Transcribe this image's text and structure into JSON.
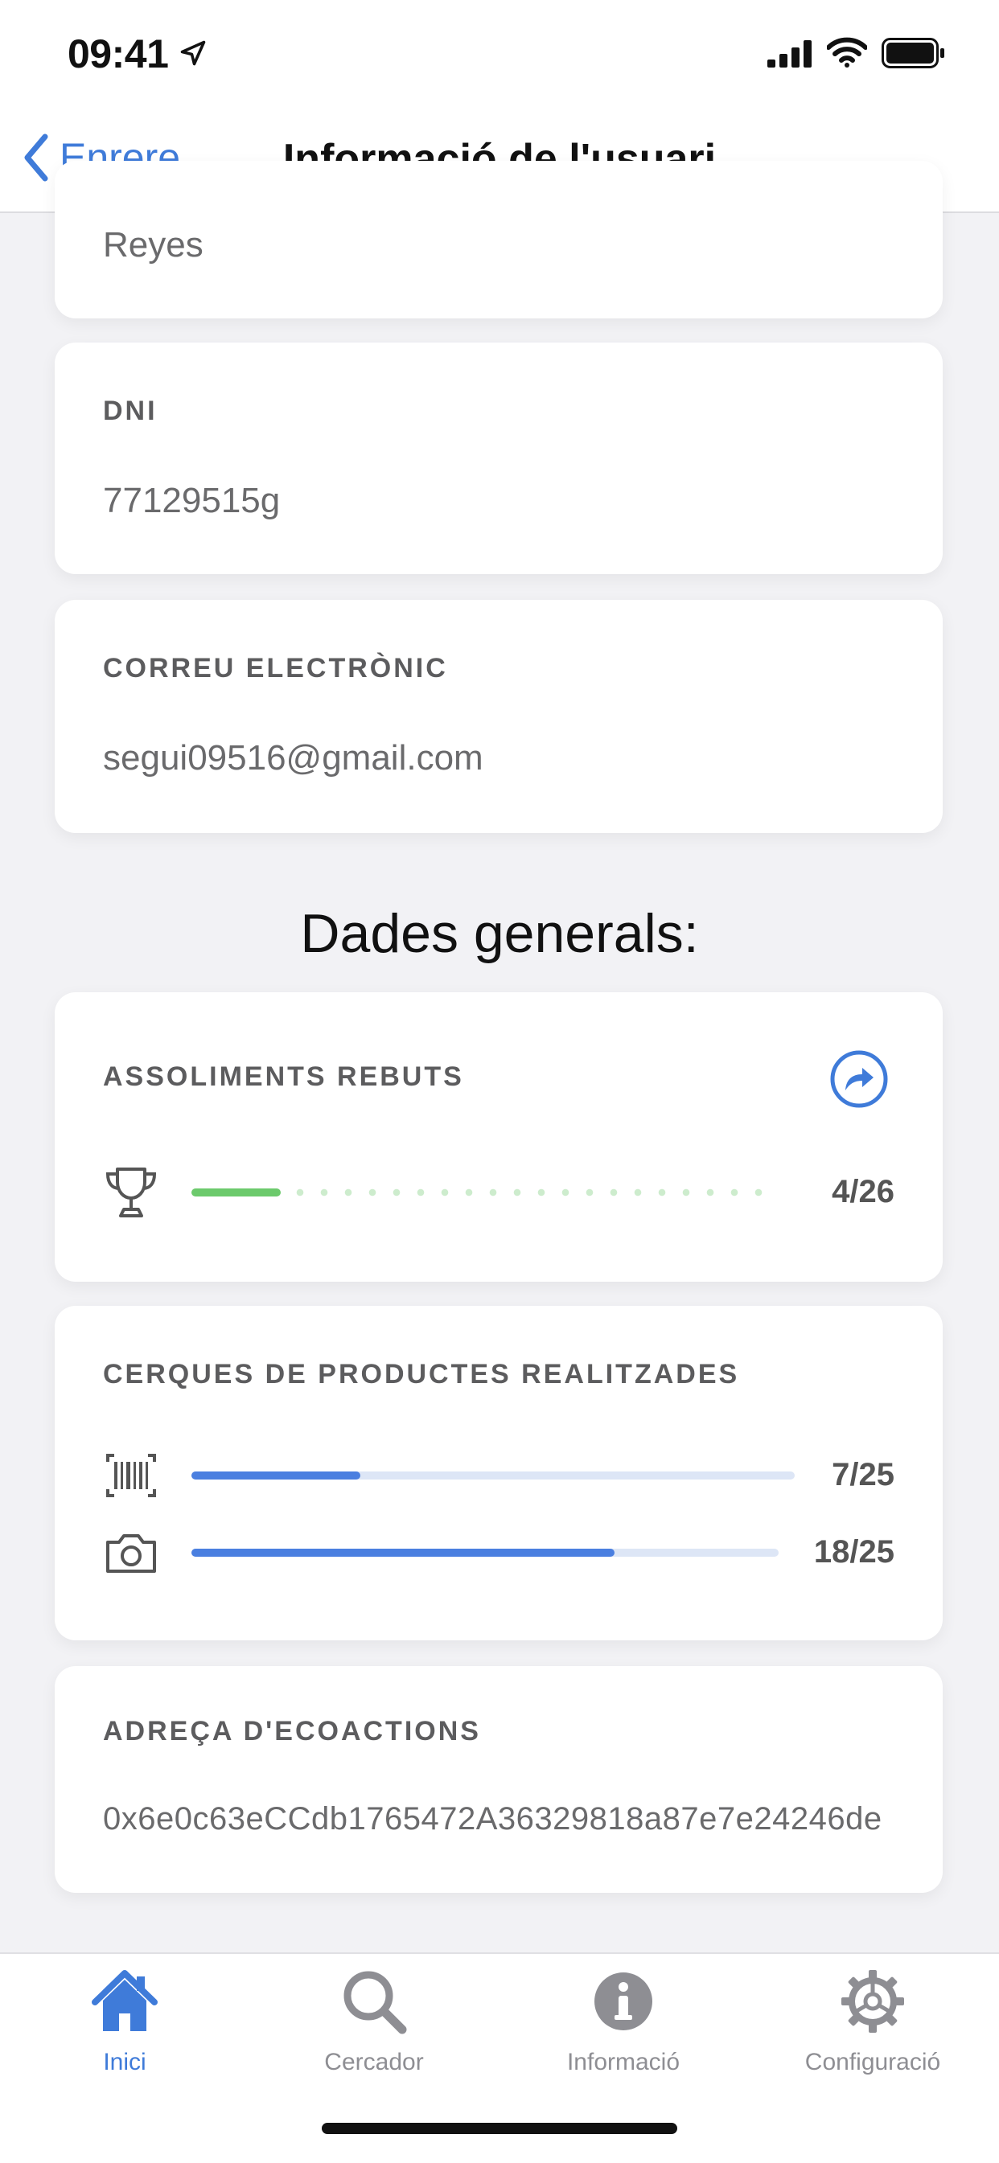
{
  "status_bar": {
    "time": "09:41"
  },
  "nav": {
    "back_label": "Enrere",
    "title": "Informació de l'usuari"
  },
  "fields": {
    "surname_value": "Reyes",
    "dni_label": "DNI",
    "dni_value": "77129515g",
    "email_label": "CORREU ELECTRÒNIC",
    "email_value": "segui09516@gmail.com"
  },
  "general": {
    "title": "Dades generals:",
    "achievements": {
      "label": "ASSOLIMENTS REBUTS",
      "count": "4/26",
      "progress": 0.154,
      "colors": {
        "fill": "#6cca6c",
        "track": "#cdeccd"
      }
    },
    "searches": {
      "label": "CERQUES DE PRODUCTES REALITZADES",
      "barcode": {
        "icon": "barcode-icon",
        "count": "7/25",
        "progress": 0.28
      },
      "camera": {
        "icon": "camera-icon",
        "count": "18/25",
        "progress": 0.72
      },
      "colors": {
        "fill": "#4a7fe0",
        "track": "#dde6f6"
      }
    },
    "ecoactions": {
      "label": "ADREÇA D'ECOACTIONS",
      "address": "0x6e0c63eCCdb1765472A36329818a87e7e24246de"
    }
  },
  "tabs": [
    {
      "label": "Inici",
      "icon": "home-icon",
      "active": true
    },
    {
      "label": "Cercador",
      "icon": "search-icon",
      "active": false
    },
    {
      "label": "Informació",
      "icon": "info-icon",
      "active": false
    },
    {
      "label": "Configuració",
      "icon": "gear-icon",
      "active": false
    }
  ],
  "colors": {
    "accent": "#3f7bd9",
    "inactive": "#8e8e93"
  }
}
